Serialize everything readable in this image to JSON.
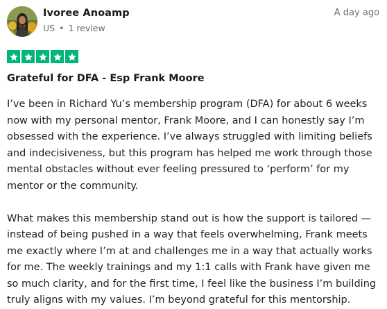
{
  "review": {
    "reviewer_name": "Ivoree Anoamp",
    "country": "US",
    "review_count": "1 review",
    "separator": "•",
    "date": "A day ago",
    "rating": 5,
    "max_rating": 5,
    "star_color": "#00b67a",
    "title": "Grateful for DFA - Esp Frank Moore",
    "paragraphs": [
      "I’ve been in Richard Yu’s membership program (DFA) for about 6 weeks now with my personal mentor, Frank Moore, and I can honestly say I’m obsessed with the experience. I’ve always struggled with limiting beliefs and indecisiveness, but this program has helped me work through those mental obstacles without ever feeling pressured to ‘perform’ for my mentor or the community.",
      "What makes this membership stand out is how the support is tailored — instead of being pushed in a way that feels overwhelming, Frank meets me exactly where I’m at and challenges me in a way that actually works for me. The weekly trainings and my 1:1 calls with Frank have given me so much clarity, and for the first time, I feel like the business I’m building truly aligns with my values. I’m beyond grateful for this mentorship."
    ]
  }
}
